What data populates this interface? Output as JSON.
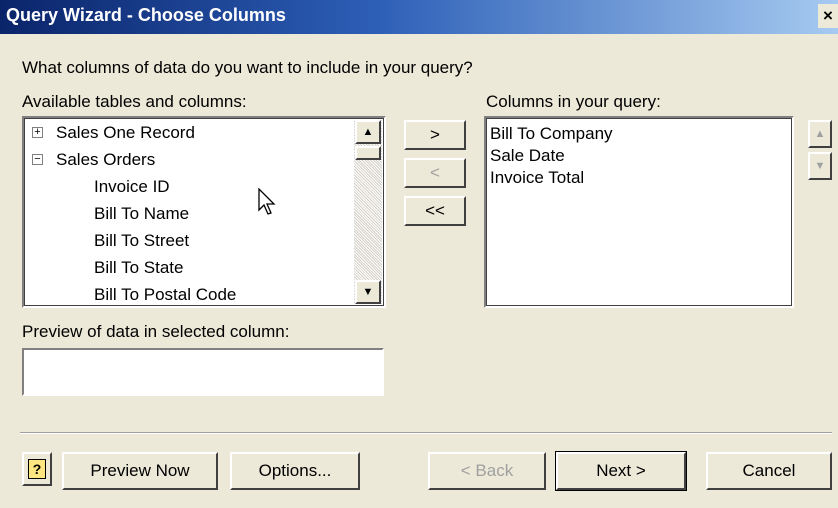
{
  "window": {
    "title": "Query Wizard - Choose Columns",
    "close_glyph": "×"
  },
  "prompt": "What columns of data do you want to include in your query?",
  "available": {
    "label": "Available tables and columns:",
    "items": [
      {
        "label": "Sales One Record",
        "expander": "+"
      },
      {
        "label": "Sales Orders",
        "expander": "−"
      },
      {
        "label": "Invoice ID"
      },
      {
        "label": "Bill To Name"
      },
      {
        "label": "Bill To Street"
      },
      {
        "label": "Bill To State"
      },
      {
        "label": "Bill To Postal Code"
      }
    ]
  },
  "transfer_buttons": {
    "add": ">",
    "remove": "<",
    "remove_all": "<<"
  },
  "query": {
    "label": "Columns in your query:",
    "items": [
      "Bill To Company",
      "Sale Date",
      "Invoice Total"
    ]
  },
  "preview": {
    "label": "Preview of data in selected column:",
    "value": ""
  },
  "footer": {
    "help": "?",
    "preview_now": "Preview Now",
    "options": "Options...",
    "back": "< Back",
    "next": "Next >",
    "cancel": "Cancel"
  },
  "colors": {
    "title_start": "#0a246a",
    "title_end": "#a6caf0",
    "face": "#ece9d8"
  }
}
